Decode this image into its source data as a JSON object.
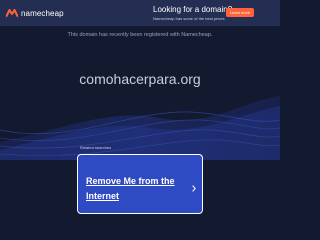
{
  "header": {
    "logo_text": "namecheap",
    "promo_title": "Looking for a domain?",
    "promo_subtitle": "Namecheap has some of the best prices",
    "promo_button": "Learn more"
  },
  "main": {
    "notice": "This domain has recently been registered with Namecheap.",
    "domain": "comohacerpara.org",
    "related_label": "Related searches",
    "results": [
      {
        "label": "Remove Me from the Internet",
        "icon": "chevron-right-icon"
      }
    ]
  },
  "colors": {
    "background": "#131a2f",
    "header": "#242e52",
    "accent": "#ff6339",
    "card": "#2e4bc4"
  }
}
